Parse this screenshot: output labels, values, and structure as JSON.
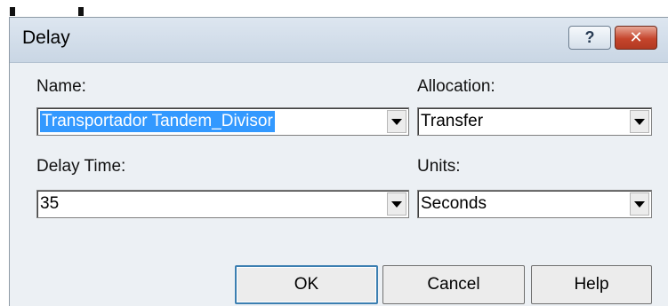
{
  "window": {
    "title": "Delay",
    "help_glyph": "?",
    "close_glyph": "✕"
  },
  "name": {
    "label": "Name:",
    "value": "Transportador Tandem_Divisor"
  },
  "allocation": {
    "label": "Allocation:",
    "value": "Transfer"
  },
  "delay_time": {
    "label": "Delay Time:",
    "value": "35"
  },
  "units": {
    "label": "Units:",
    "value": "Seconds"
  },
  "buttons": {
    "ok": "OK",
    "cancel": "Cancel",
    "help": "Help"
  },
  "colors": {
    "selection": "#3399ff",
    "dialog_bg": "#ecf0f4",
    "titlebar": "#c9d6e4",
    "close": "#c5452c"
  }
}
